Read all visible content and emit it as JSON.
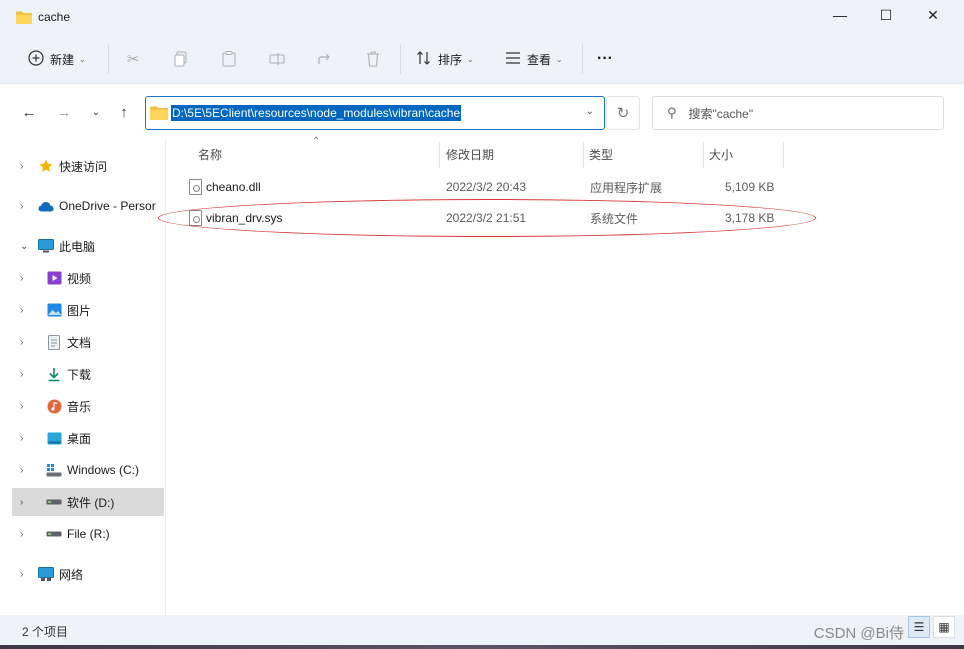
{
  "window": {
    "title": "cache"
  },
  "window_controls": {
    "minimize": "—",
    "maximize": "☐",
    "close": "✕"
  },
  "toolbar": {
    "new_label": "新建",
    "sort_label": "排序",
    "view_label": "查看",
    "more": "···"
  },
  "address": {
    "path": "D:\\5E\\5EClient\\resources\\node_modules\\vibran\\cache"
  },
  "search": {
    "placeholder": "搜索\"cache\""
  },
  "sidebar": {
    "items": [
      {
        "label": "快速访问",
        "icon": "star-icon"
      },
      {
        "label": "OneDrive - Persor",
        "icon": "cloud-icon"
      },
      {
        "label": "此电脑",
        "icon": "monitor-icon"
      },
      {
        "label": "视频",
        "icon": "video-icon"
      },
      {
        "label": "图片",
        "icon": "picture-icon"
      },
      {
        "label": "文档",
        "icon": "document-icon"
      },
      {
        "label": "下载",
        "icon": "download-icon"
      },
      {
        "label": "音乐",
        "icon": "music-icon"
      },
      {
        "label": "桌面",
        "icon": "desktop-icon"
      },
      {
        "label": "Windows (C:)",
        "icon": "drive-icon"
      },
      {
        "label": "软件 (D:)",
        "icon": "drive-icon"
      },
      {
        "label": "File (R:)",
        "icon": "drive-icon"
      },
      {
        "label": "网络",
        "icon": "network-icon"
      }
    ]
  },
  "columns": {
    "name": "名称",
    "modified": "修改日期",
    "type": "类型",
    "size": "大小"
  },
  "files": [
    {
      "name": "cheano.dll",
      "modified": "2022/3/2 20:43",
      "type": "应用程序扩展",
      "size": "5,109 KB"
    },
    {
      "name": "vibran_drv.sys",
      "modified": "2022/3/2 21:51",
      "type": "系统文件",
      "size": "3,178 KB"
    }
  ],
  "status": {
    "count": "2 个项目"
  },
  "watermark": "CSDN @Bi侍"
}
